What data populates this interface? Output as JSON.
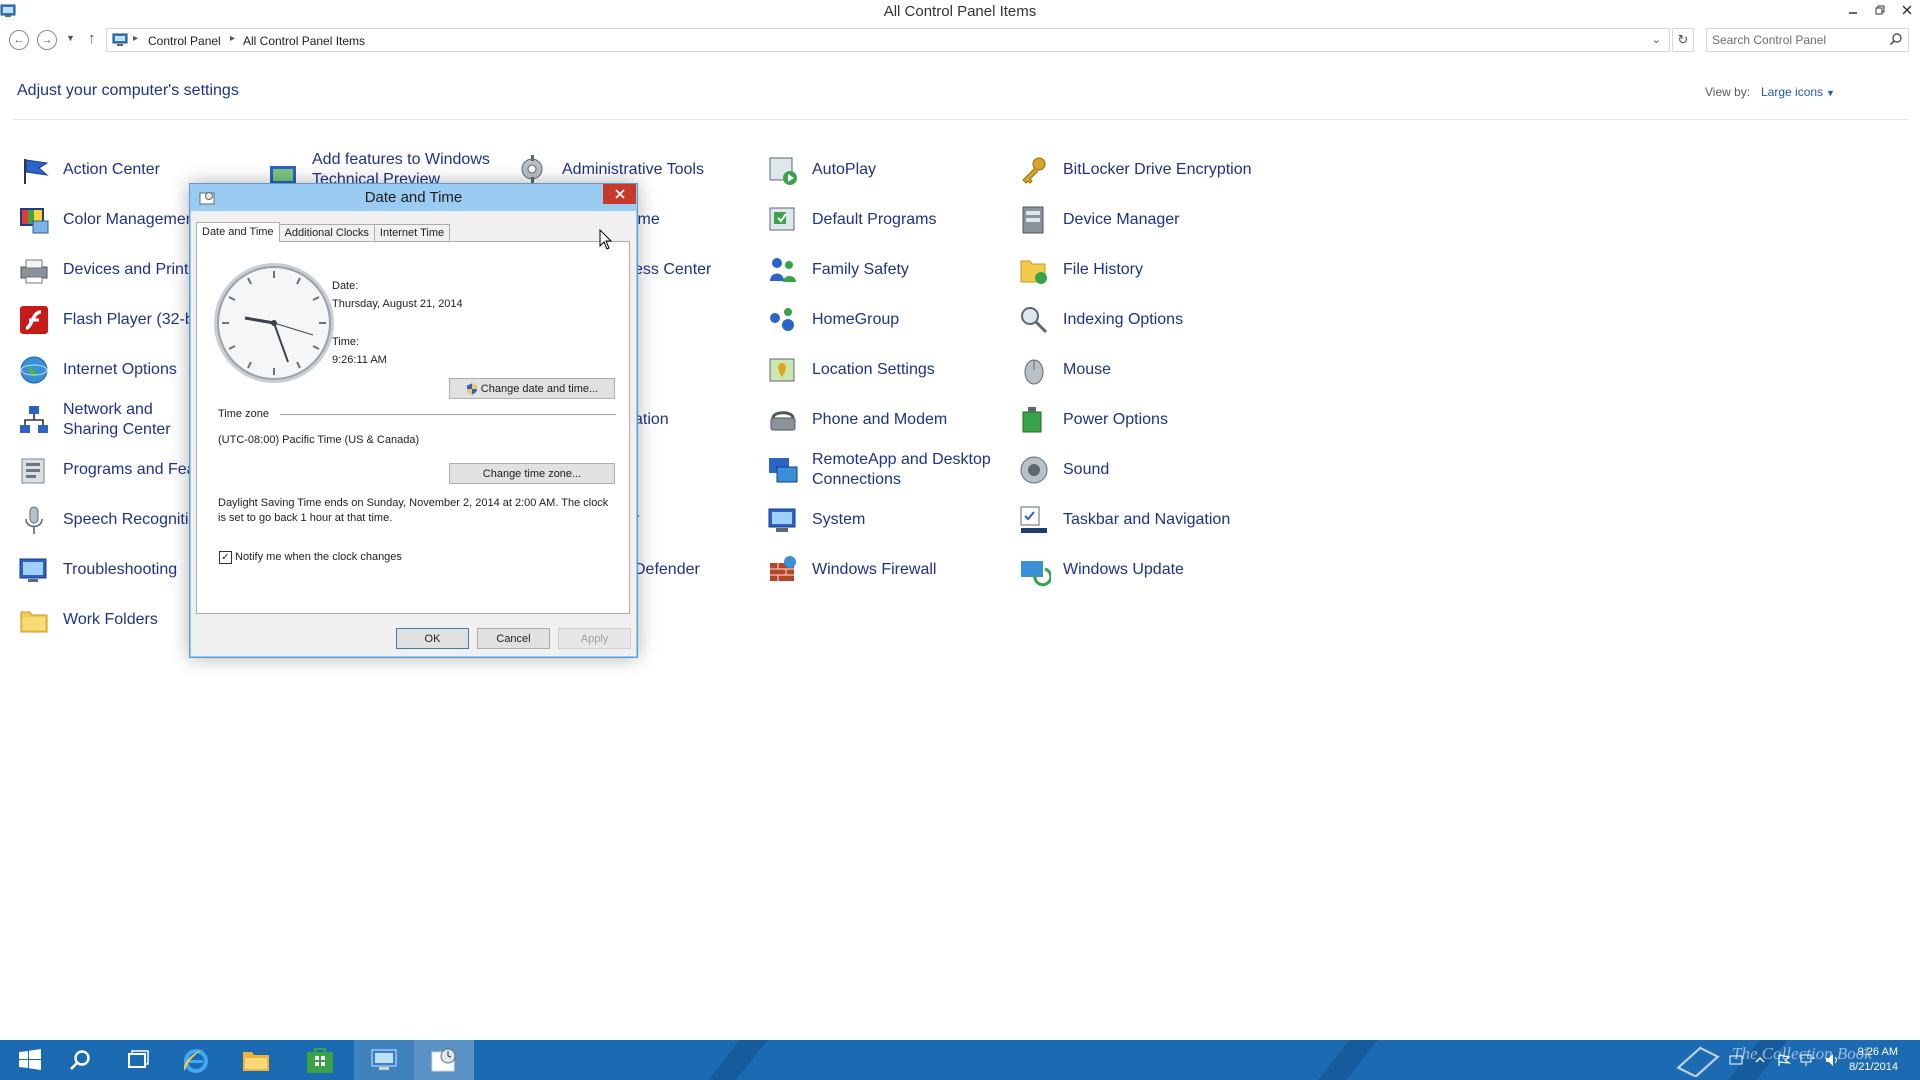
{
  "window": {
    "title": "All Control Panel Items"
  },
  "address": {
    "crumbs": [
      "Control Panel",
      "All Control Panel Items"
    ],
    "search_placeholder": "Search Control Panel"
  },
  "header": {
    "heading": "Adjust your computer's settings",
    "view_by_label": "View by:",
    "view_by_value": "Large icons"
  },
  "items": {
    "col1": [
      "Action Center",
      "Color Management",
      "Devices and Printers",
      "Flash Player (32-bit)",
      "Internet Options",
      "Network and Sharing Center",
      "Programs and Features",
      "Speech Recognition",
      "Troubleshooting",
      "Work Folders"
    ],
    "col2_top": "Add features to Windows Technical Preview",
    "col3_partial": [
      "Administrative Tools",
      "ime",
      "ess Center",
      "ation",
      "r",
      "Defender"
    ],
    "col4": [
      "AutoPlay",
      "Default Programs",
      "Family Safety",
      "HomeGroup",
      "Location Settings",
      "Phone and Modem",
      "RemoteApp and Desktop Connections",
      "System",
      "Windows Firewall"
    ],
    "col5": [
      "BitLocker Drive Encryption",
      "Device Manager",
      "File History",
      "Indexing Options",
      "Mouse",
      "Power Options",
      "Sound",
      "Taskbar and Navigation",
      "Windows Update"
    ]
  },
  "dialog": {
    "title": "Date and Time",
    "tabs": [
      "Date and Time",
      "Additional Clocks",
      "Internet Time"
    ],
    "date_label": "Date:",
    "date_value": "Thursday, August 21, 2014",
    "time_label": "Time:",
    "time_value": "9:26:11 AM",
    "change_datetime_button": "Change date and time...",
    "timezone_heading": "Time zone",
    "timezone_value": "(UTC-08:00) Pacific Time (US & Canada)",
    "change_timezone_button": "Change time zone...",
    "dst_text": "Daylight Saving Time ends on Sunday, November 2, 2014 at 2:00 AM. The clock is set to go back 1 hour at that time.",
    "notify_checkbox_label": "Notify me when the clock changes",
    "notify_checked": true,
    "ok": "OK",
    "cancel": "Cancel",
    "apply": "Apply"
  },
  "taskbar": {
    "time": "9:26 AM",
    "date": "8/21/2014",
    "watermark": "The Collection Book"
  },
  "colors": {
    "link": "#1e3287",
    "taskbar": "#1c6ab2",
    "dialog_frame": "#9acbf0",
    "close_red": "#c7392a"
  }
}
